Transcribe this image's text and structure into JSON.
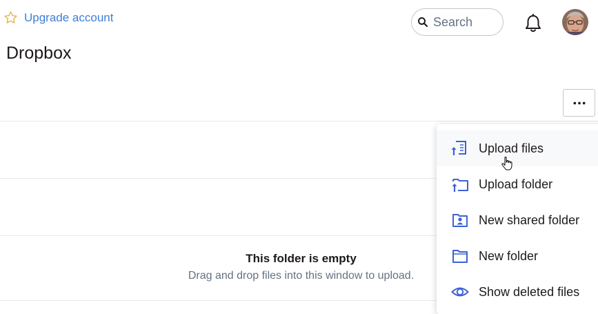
{
  "header": {
    "upgrade_label": "Upgrade account",
    "search_placeholder": "Search",
    "page_title": "Dropbox"
  },
  "empty_state": {
    "title": "This folder is empty",
    "subtitle": "Drag and drop files into this window to upload."
  },
  "menu": {
    "items": [
      {
        "label": "Upload files",
        "icon": "upload-file-icon",
        "hovered": true
      },
      {
        "label": "Upload folder",
        "icon": "upload-folder-icon"
      },
      {
        "label": "New shared folder",
        "icon": "shared-folder-icon"
      },
      {
        "label": "New folder",
        "icon": "folder-icon"
      },
      {
        "label": "Show deleted files",
        "icon": "eye-icon"
      }
    ]
  },
  "colors": {
    "accent_blue": "#3d7fd6",
    "icon_blue": "#3a62d6",
    "star_gold": "#e3b23c",
    "text_dark": "#1e1919",
    "text_muted": "#637282"
  }
}
